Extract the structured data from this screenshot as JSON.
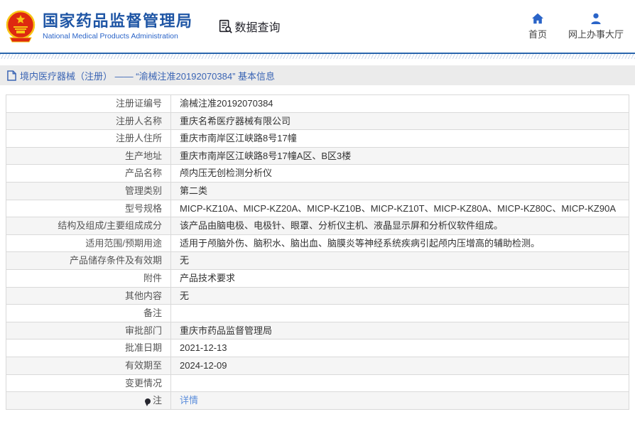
{
  "header": {
    "logo": {
      "emblem_icon": "china-national-emblem",
      "org_name_cn": "国家药品监督管理局",
      "org_name_en": "National Medical Products Administration"
    },
    "data_query_label": "数据查询",
    "nav": {
      "home_label": "首页",
      "service_hall_label": "网上办事大厅"
    }
  },
  "breadcrumb": {
    "text": "境内医疗器械（注册） —— “渝械注准20192070384” 基本信息"
  },
  "info_table": {
    "rows": [
      {
        "label": "注册证编号",
        "value": "渝械注准20192070384"
      },
      {
        "label": "注册人名称",
        "value": "重庆名希医疗器械有限公司"
      },
      {
        "label": "注册人住所",
        "value": "重庆市南岸区江峡路8号17幢"
      },
      {
        "label": "生产地址",
        "value": "重庆市南岸区江峡路8号17幢A区、B区3楼"
      },
      {
        "label": "产品名称",
        "value": "颅内压无创检测分析仪"
      },
      {
        "label": "管理类别",
        "value": "第二类"
      },
      {
        "label": "型号规格",
        "value": "MICP-KZ10A、MICP-KZ20A、MICP-KZ10B、MICP-KZ10T、MICP-KZ80A、MICP-KZ80C、MICP-KZ90A"
      },
      {
        "label": "结构及组成/主要组成成分",
        "value": "该产品由脑电极、电极针、眼罩、分析仪主机、液晶显示屏和分析仪软件组成。"
      },
      {
        "label": "适用范围/预期用途",
        "value": "适用于颅脑外伤、脑积水、脑出血、脑膜炎等神经系统疾病引起颅内压增高的辅助检测。"
      },
      {
        "label": "产品储存条件及有效期",
        "value": "无"
      },
      {
        "label": "附件",
        "value": "产品技术要求"
      },
      {
        "label": "其他内容",
        "value": "无"
      },
      {
        "label": "备注",
        "value": ""
      },
      {
        "label": "审批部门",
        "value": "重庆市药品监督管理局"
      },
      {
        "label": "批准日期",
        "value": "2021-12-13"
      },
      {
        "label": "有效期至",
        "value": "2024-12-09"
      },
      {
        "label": "变更情况",
        "value": ""
      },
      {
        "label": "注",
        "value": "详情",
        "value_is_link": true,
        "label_icon": "note-balloon-icon"
      }
    ]
  },
  "colors": {
    "title_blue": "#1f56a5",
    "icon_blue": "#2a64c8",
    "divider_blue": "#2a66ad",
    "breadcrumb_bg": "#ebebeb",
    "breadcrumb_text": "#3a64b4",
    "link_blue": "#5b8ddb",
    "label_text": "#555555",
    "value_text": "#333333",
    "table_border": "#d9d9d9",
    "row_alt_bg": "#f5f5f5",
    "emblem_red": "#de2910",
    "emblem_gold": "#f7c514"
  }
}
